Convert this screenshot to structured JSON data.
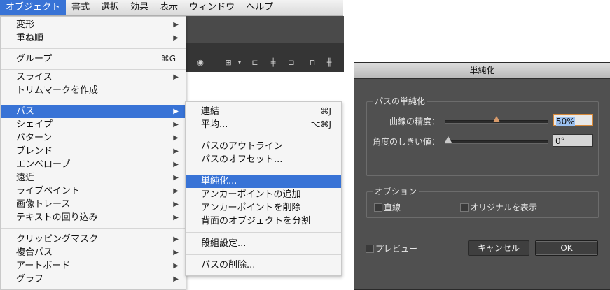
{
  "menubar": {
    "items": [
      "オブジェクト",
      "書式",
      "選択",
      "効果",
      "表示",
      "ウィンドウ",
      "ヘルプ"
    ]
  },
  "main_menu": {
    "items": [
      {
        "label": "変形",
        "submenu": true
      },
      {
        "label": "重ね順",
        "submenu": true
      },
      {
        "label": "グループ",
        "shortcut": "⌘G"
      },
      {
        "label": "スライス",
        "submenu": true
      },
      {
        "label": "トリムマークを作成"
      },
      {
        "label": "パス",
        "submenu": true,
        "highlighted": true
      },
      {
        "label": "シェイプ",
        "submenu": true
      },
      {
        "label": "パターン",
        "submenu": true
      },
      {
        "label": "ブレンド",
        "submenu": true
      },
      {
        "label": "エンベロープ",
        "submenu": true
      },
      {
        "label": "遠近",
        "submenu": true
      },
      {
        "label": "ライブペイント",
        "submenu": true
      },
      {
        "label": "画像トレース",
        "submenu": true
      },
      {
        "label": "テキストの回り込み",
        "submenu": true
      },
      {
        "label": "クリッピングマスク",
        "submenu": true
      },
      {
        "label": "複合パス",
        "submenu": true
      },
      {
        "label": "アートボード",
        "submenu": true
      },
      {
        "label": "グラフ",
        "submenu": true
      }
    ],
    "arrow": "▶"
  },
  "sub_menu": {
    "items": [
      {
        "label": "連結",
        "shortcut": "⌘J"
      },
      {
        "label": "平均...",
        "shortcut": "⌥⌘J"
      },
      {
        "label": "パスのアウトライン"
      },
      {
        "label": "パスのオフセット..."
      },
      {
        "label": "単純化...",
        "highlighted": true
      },
      {
        "label": "アンカーポイントの追加"
      },
      {
        "label": "アンカーポイントを削除"
      },
      {
        "label": "背面のオブジェクトを分割"
      },
      {
        "label": "段組設定..."
      },
      {
        "label": "パスの削除..."
      }
    ]
  },
  "dialog": {
    "title": "単純化",
    "path_group": {
      "legend": "パスの単純化",
      "curve_precision_label": "曲線の精度：",
      "curve_precision_value": "50%",
      "curve_precision_level": 50,
      "angle_threshold_label": "角度のしきい値：",
      "angle_threshold_value": "0°",
      "angle_threshold_level": 0
    },
    "options_group": {
      "legend": "オプション",
      "straight_lines_label": "直線",
      "straight_lines_checked": false,
      "show_original_label": "オリジナルを表示",
      "show_original_checked": false
    },
    "preview_label": "プレビュー",
    "preview_checked": false,
    "cancel_label": "キャンセル",
    "ok_label": "OK"
  },
  "colors": {
    "menu_highlight": "#3873d6",
    "dialog_bg": "#505050",
    "focus_ring": "#d88a3a"
  }
}
